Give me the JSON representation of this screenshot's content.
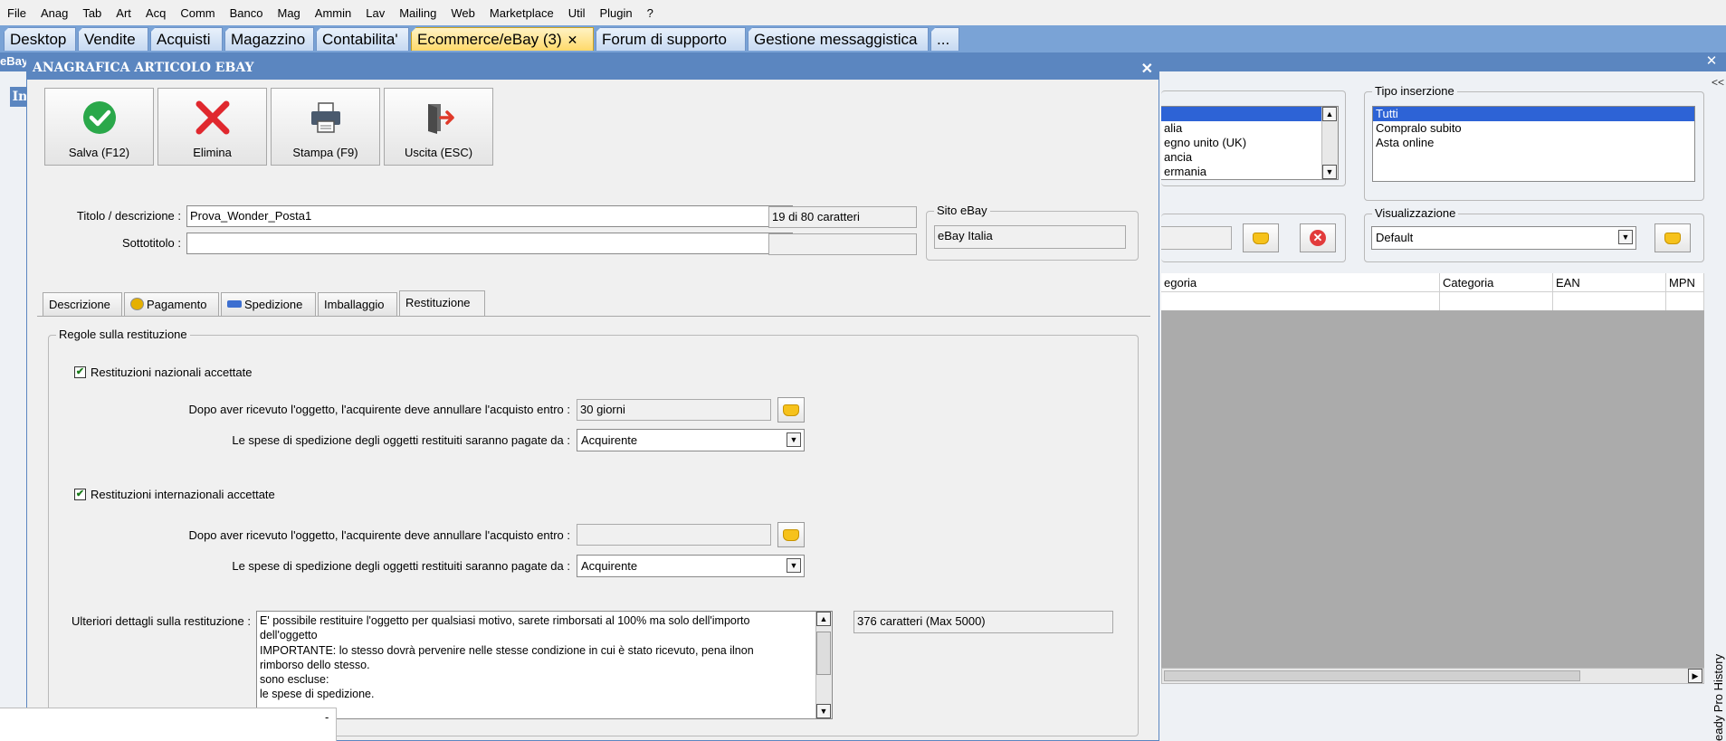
{
  "menu": [
    "File",
    "Anag",
    "Tab",
    "Art",
    "Acq",
    "Comm",
    "Banco",
    "Mag",
    "Ammin",
    "Lav",
    "Mailing",
    "Web",
    "Marketplace",
    "Util",
    "Plugin",
    "?"
  ],
  "tabs": {
    "desktop": "Desktop",
    "vendite": "Vendite",
    "acquisti": "Acquisti",
    "magazzino": "Magazzino",
    "contabilita": "Contabilita'",
    "ecommerce": "Ecommerce/eBay (3)",
    "forum": "Forum di supporto",
    "messaggistica": "Gestione messaggistica",
    "more": "..."
  },
  "background_window": {
    "title": "eBay",
    "side_tab_left": "In",
    "site_list": [
      "alia",
      "egno unito (UK)",
      "ancia",
      "ermania"
    ],
    "tipo_inserzione": {
      "title": "Tipo inserzione",
      "items": [
        "Tutti",
        "Compralo subito",
        "Asta online"
      ],
      "selected": "Tutti"
    },
    "visualizzazione": {
      "title": "Visualizzazione",
      "value": "Default"
    },
    "grid_columns": [
      "egoria",
      "Categoria",
      "EAN",
      "MPN"
    ],
    "collapse_glyph": "<<",
    "side_vertical_label": "eady Pro    History"
  },
  "dialog": {
    "title": "ANAGRAFICA ARTICOLO EBAY",
    "toolbar": {
      "salva": "Salva (F12)",
      "elimina": "Elimina",
      "stampa": "Stampa (F9)",
      "uscita": "Uscita (ESC)"
    },
    "titolo_label": "Titolo / descrizione :",
    "titolo_value": "Prova_Wonder_Posta1",
    "titolo_count": "19 di 80 caratteri",
    "sottotitolo_label": "Sottotitolo :",
    "sottotitolo_value": "",
    "sito": {
      "title": "Sito eBay",
      "value": "eBay Italia"
    },
    "tabs": {
      "descrizione": "Descrizione",
      "pagamento": "Pagamento",
      "spedizione": "Spedizione",
      "imballaggio": "Imballaggio",
      "restituzione": "Restituzione"
    },
    "regole": {
      "title": "Regole sulla restituzione",
      "nazionali_label": "Restituzioni nazionali accettate",
      "nazionali_checked": true,
      "naz_entro_label": "Dopo aver ricevuto l'oggetto, l'acquirente deve annullare l'acquisto entro :",
      "naz_entro_value": "30 giorni",
      "naz_spese_label": "Le spese di spedizione degli oggetti restituiti saranno pagate da :",
      "naz_spese_value": "Acquirente",
      "internazionali_label": "Restituzioni internazionali accettate",
      "internazionali_checked": true,
      "int_entro_label": "Dopo aver ricevuto l'oggetto, l'acquirente deve annullare l'acquisto entro :",
      "int_entro_value": "",
      "int_spese_label": "Le spese di spedizione degli oggetti restituiti saranno pagate da :",
      "int_spese_value": "Acquirente",
      "dettagli_label": "Ulteriori dettagli sulla restituzione :",
      "dettagli_lines": [
        "E' possibile restituire l'oggetto per qualsiasi motivo, sarete rimborsati al 100% ma solo dell'importo",
        "dell'oggetto",
        "IMPORTANTE: lo stesso dovrà pervenire nelle stesse condizione in cui è stato ricevuto, pena ilnon",
        "rimborso dello stesso.",
        "sono escluse:",
        "le spese di spedizione."
      ],
      "dettagli_count": "376 caratteri (Max 5000)"
    }
  },
  "bottom_popup_glyph": "-",
  "colors": {
    "tab_strip": "#7aa3d6",
    "active_tab": "#ffd96a",
    "title_bar": "#5b86c0",
    "selection": "#2d63d6",
    "save_green": "#2aa84a",
    "delete_red": "#e0282e"
  }
}
